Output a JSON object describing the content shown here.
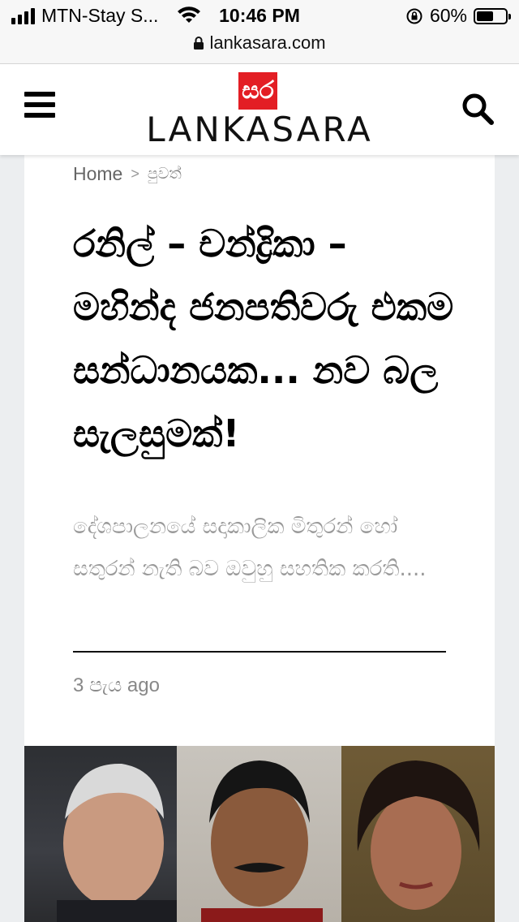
{
  "status_bar": {
    "carrier": "MTN-Stay S...",
    "time": "10:46 PM",
    "battery_percent": "60%",
    "battery_level": 0.6,
    "icons": [
      "signal-icon",
      "wifi-icon",
      "rotation-lock-icon",
      "battery-icon"
    ]
  },
  "browser": {
    "url": "lankasara.com"
  },
  "header": {
    "logo_mark": "සර",
    "logo_text": "LANKASARA",
    "brand_color": "#e31e24",
    "icons": [
      "menu-icon",
      "search-icon"
    ]
  },
  "breadcrumb": {
    "home": "Home",
    "separator": ">",
    "current": "පුවත්"
  },
  "article": {
    "title": "රනිල් – චන්ද්‍රිකා – මහින්ද ජනපතිවරු එකම සන්ධානයක... නව බල සැලසුමක්!",
    "excerpt": "දේශපාලනයේ සදාකාලික මිතුරන් හෝ සතුරන් නැති බව ඔවුහු සහතික කරති....",
    "time_ago": "3 පැය ago"
  },
  "hero_image": {
    "panels": [
      "portrait-left",
      "portrait-center",
      "portrait-right"
    ]
  }
}
